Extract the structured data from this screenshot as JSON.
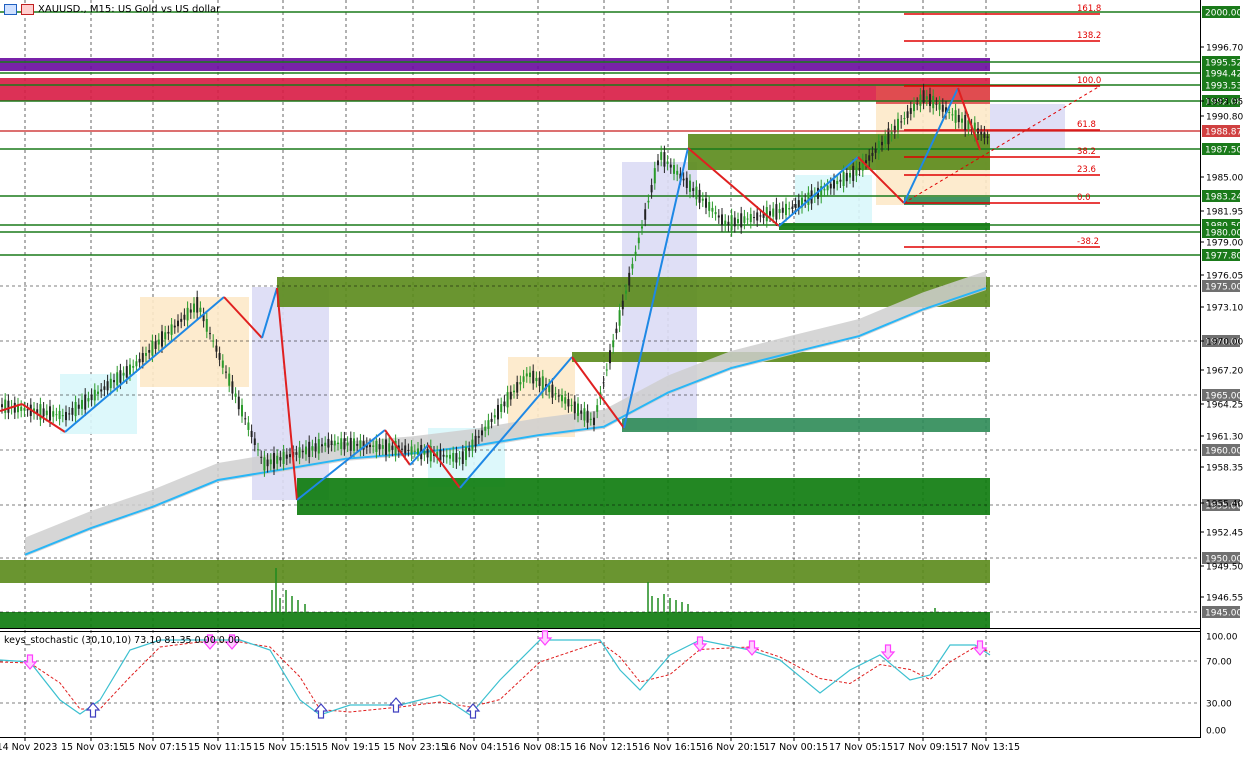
{
  "chart_title": {
    "symbol": "XAUUSD.",
    "timeframe": "M15",
    "description": "US Gold vs US dollar",
    "text": "XAUUSD., M15:  US Gold vs US dollar"
  },
  "indicator": {
    "label": "keys_stochastic (30,10,10) 73.10 81.35 0.00 0.00",
    "levels": [
      "100.00",
      "70.00",
      "30.00",
      "0.00"
    ]
  },
  "price_axis": {
    "ticks": [
      "1996.70",
      "1993.95",
      "1990.80",
      "1985.00",
      "1981.95",
      "1979.00",
      "1976.05",
      "1973.10",
      "1970.00",
      "1967.20",
      "1964.25",
      "1961.30",
      "1958.35",
      "1955.40",
      "1952.45",
      "1949.50",
      "1946.55"
    ]
  },
  "price_levels": [
    {
      "label": "2000.00",
      "color": "#1a7a1a"
    },
    {
      "label": "1995.52",
      "color": "#1a7a1a"
    },
    {
      "label": "1994.42",
      "color": "#1a7a1a"
    },
    {
      "label": "1993.53",
      "color": "#1a7a1a"
    },
    {
      "label": "1992.08",
      "color": "#1a7a1a"
    },
    {
      "label": "1988.87",
      "color": "#d04040"
    },
    {
      "label": "1987.50",
      "color": "#1a7a1a"
    },
    {
      "label": "1983.24",
      "color": "#1a7a1a"
    },
    {
      "label": "1980.50",
      "color": "#1a7a1a"
    },
    {
      "label": "1980.00",
      "color": "#1a7a1a"
    },
    {
      "label": "1977.80",
      "color": "#1a7a1a"
    },
    {
      "label": "1975.00",
      "color": "#707070"
    },
    {
      "label": "1970.00",
      "color": "#707070"
    },
    {
      "label": "1965.00",
      "color": "#707070"
    },
    {
      "label": "1960.00",
      "color": "#707070"
    },
    {
      "label": "1955.00",
      "color": "#707070"
    },
    {
      "label": "1950.00",
      "color": "#707070"
    },
    {
      "label": "1945.00",
      "color": "#707070"
    }
  ],
  "fib_labels": [
    "161.8",
    "138.2",
    "100.0",
    "61.8",
    "38.2",
    "23.6",
    "0.0",
    "-38.2"
  ],
  "time_axis": {
    "labels": [
      "14 Nov 2023",
      "15 Nov 03:15",
      "15 Nov 07:15",
      "15 Nov 11:15",
      "15 Nov 15:15",
      "15 Nov 19:15",
      "15 Nov 23:15",
      "16 Nov 04:15",
      "16 Nov 08:15",
      "16 Nov 12:15",
      "16 Nov 16:15",
      "16 Nov 20:15",
      "17 Nov 00:15",
      "17 Nov 05:15",
      "17 Nov 09:15",
      "17 Nov 13:15"
    ]
  },
  "chart_data": {
    "type": "line",
    "title": "XAUUSD., M15:  US Gold vs US dollar",
    "ylim": [
      1943.5,
      2001.5
    ],
    "x": [
      "14 Nov 2023",
      "15 Nov 03:15",
      "15 Nov 07:15",
      "15 Nov 11:15",
      "15 Nov 15:15",
      "15 Nov 19:15",
      "15 Nov 23:15",
      "16 Nov 04:15",
      "16 Nov 08:15",
      "16 Nov 12:15",
      "16 Nov 16:15",
      "16 Nov 20:15",
      "17 Nov 00:15",
      "17 Nov 05:15",
      "17 Nov 09:15",
      "17 Nov 13:15"
    ],
    "series": [
      {
        "values": [
          1964.0,
          1963.0,
          1967.5,
          1973.5,
          1958.5,
          1960.5,
          1960.0,
          1959.0,
          1967.0,
          1962.5,
          1987.5,
          1981.0,
          1982.5,
          1986.0,
          1993.0,
          1989.0
        ]
      },
      {
        "values": [
          1950.0,
          1952.5,
          1954.5,
          1957.0,
          1958.0,
          1959.0,
          1959.5,
          1960.2,
          1961.2,
          1962.0,
          1965.2,
          1967.5,
          1969.0,
          1970.5,
          1973.0,
          1975.0
        ]
      }
    ],
    "grid": true
  },
  "colors": {
    "bull": "#2a9a2a",
    "bear": "#222222",
    "swing_up": "#1e88e5",
    "swing_down": "#e02020",
    "ema": "#29b6f6",
    "ma_band": "#cfcfcf",
    "fib": "#e00000",
    "k_line": "#3cc0d0",
    "d_line": "#e02020",
    "arrow": "#ff40ff"
  }
}
